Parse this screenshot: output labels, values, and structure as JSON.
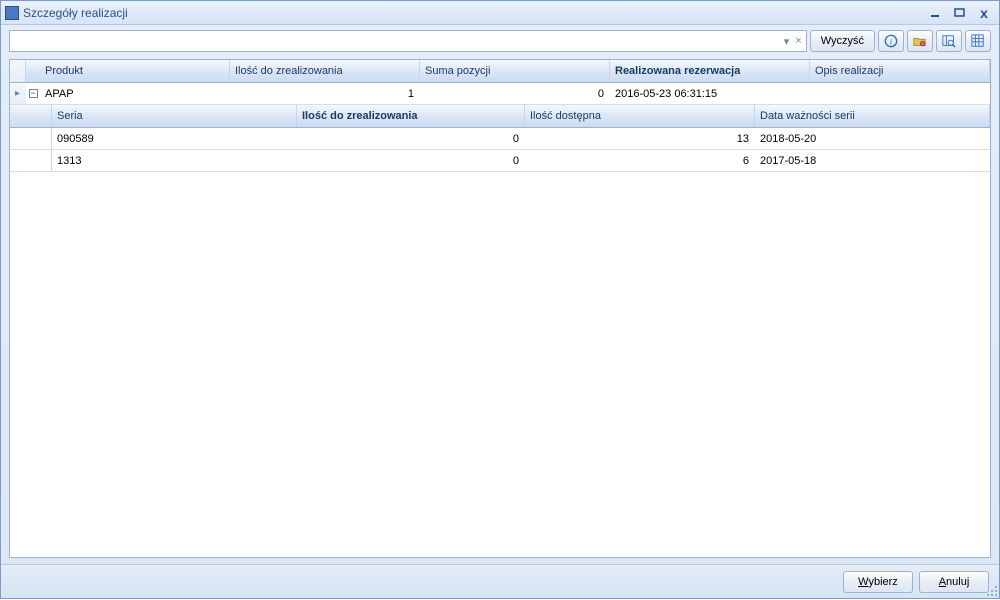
{
  "window": {
    "title": "Szczegóły realizacji"
  },
  "toolbar": {
    "search_value": "",
    "clear_label": "Wyczyść"
  },
  "grid": {
    "columns": {
      "product": "Produkt",
      "qty": "Ilość do zrealizowania",
      "sum": "Suma pozycji",
      "reservation": "Realizowana rezerwacja",
      "desc": "Opis realizacji"
    },
    "row": {
      "product": "APAP",
      "qty": "1",
      "sum": "0",
      "reservation": "2016-05-23 06:31:15",
      "desc": ""
    },
    "sub_columns": {
      "series": "Seria",
      "qty": "Ilość do zrealizowania",
      "avail": "Ilość dostępna",
      "expiry": "Data ważności serii"
    },
    "sub_rows": [
      {
        "series": "090589",
        "qty": "0",
        "avail": "13",
        "expiry": "2018-05-20"
      },
      {
        "series": "1313",
        "qty": "0",
        "avail": "6",
        "expiry": "2017-05-18"
      }
    ]
  },
  "footer": {
    "select": "Wybierz",
    "cancel": "Anuluj"
  }
}
